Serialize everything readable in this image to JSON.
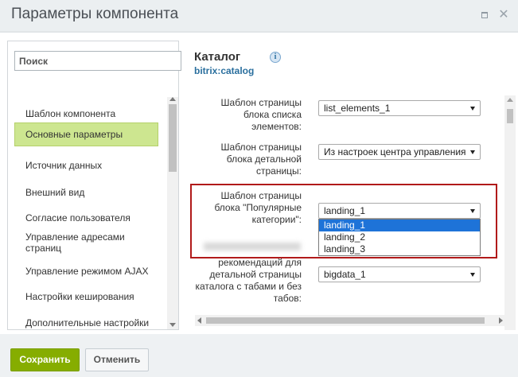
{
  "window": {
    "title": "Параметры компонента"
  },
  "sidebar": {
    "search_placeholder": "Поиск",
    "items": [
      {
        "label": "Шаблон компонента"
      },
      {
        "label": "Основные параметры"
      },
      {
        "label": "Источник данных"
      },
      {
        "label": "Внешний вид"
      },
      {
        "label": "Согласие пользователя"
      },
      {
        "label": "Управление адресами страниц"
      },
      {
        "label": "Управление режимом AJAX"
      },
      {
        "label": "Настройки кеширования"
      },
      {
        "label": "Дополнительные настройки"
      }
    ],
    "active_item": "Основные параметры"
  },
  "component": {
    "name": "Каталог",
    "code": "bitrix:catalog",
    "info_glyph": "i"
  },
  "params": [
    {
      "label": "Шаблон страницы блока списка элементов:",
      "value": "list_elements_1"
    },
    {
      "label": "Шаблон страницы блока детальной страницы:",
      "value": "Из настроек центра управления"
    },
    {
      "label": "Шаблон страницы блока \"Популярные категории\":",
      "value": "landing_1"
    },
    {
      "label": "рекомендаций для детальной страницы каталога с табами и без табов:",
      "value": "bigdata_1"
    }
  ],
  "dropdown": {
    "options": [
      "landing_1",
      "landing_2",
      "landing_3"
    ],
    "selected": "landing_1"
  },
  "footer": {
    "save_label": "Сохранить",
    "cancel_label": "Отменить"
  },
  "colors": {
    "save_button": "#86ad00",
    "active_nav": "#cde690",
    "highlight_border": "#b11a1a",
    "selected_option": "#1e73d8",
    "component_code": "#2a6f9e"
  }
}
